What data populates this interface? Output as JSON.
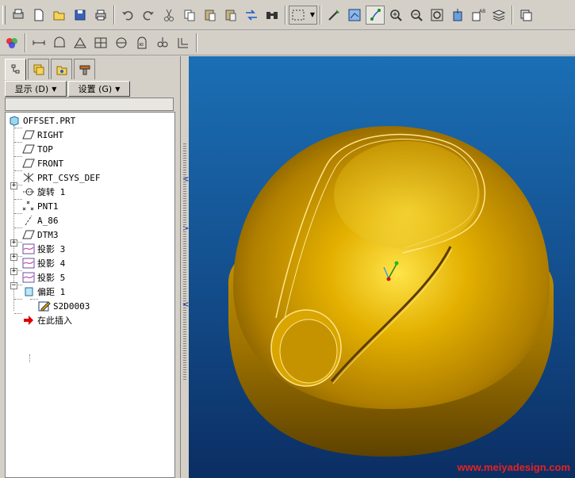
{
  "toolbar1": {
    "buttons": [
      "print-setup-icon",
      "new-icon",
      "open-icon",
      "save-icon",
      "print-icon",
      "undo-icon",
      "redo-icon",
      "cut-icon",
      "copy-icon",
      "paste-icon",
      "paste-special-icon",
      "regenerate-icon",
      "find-icon",
      "selection-box-icon",
      "repaint-icon",
      "spin-center-icon",
      "orient-icon",
      "zoom-in-icon",
      "zoom-out-icon",
      "refit-icon",
      "saved-view-icon",
      "annotation-display-icon",
      "layers-icon",
      "window-icon"
    ]
  },
  "toolbar2": {
    "buttons": [
      "model-display-icon",
      "datum-planes-icon",
      "datum-axes-icon",
      "datum-points-icon",
      "coord-sys-icon",
      "shading-icon",
      "wireframe-icon",
      "hidden-line-icon",
      "no-hidden-icon"
    ]
  },
  "panel": {
    "tabs": [
      "model-tree-tab",
      "layer-tree-tab",
      "favorites-tab",
      "tools-tab"
    ],
    "show_menu": "显示 (D)",
    "settings_menu": "设置 (G)"
  },
  "tree": {
    "items": [
      {
        "label": "OFFSET.PRT",
        "icon": "part-icon"
      },
      {
        "label": "RIGHT",
        "icon": "datum-plane-icon"
      },
      {
        "label": "TOP",
        "icon": "datum-plane-icon"
      },
      {
        "label": "FRONT",
        "icon": "datum-plane-icon"
      },
      {
        "label": "PRT_CSYS_DEF",
        "icon": "coordinate-system-icon"
      },
      {
        "label": "旋转 1",
        "icon": "revolve-icon"
      },
      {
        "label": "PNT1",
        "icon": "datum-point-icon"
      },
      {
        "label": "A_86",
        "icon": "datum-axis-icon"
      },
      {
        "label": "DTM3",
        "icon": "datum-plane-icon"
      },
      {
        "label": "投影 3",
        "icon": "projected-curve-icon"
      },
      {
        "label": "投影 4",
        "icon": "projected-curve-icon"
      },
      {
        "label": "投影 5",
        "icon": "projected-curve-icon"
      },
      {
        "label": "偏距 1",
        "icon": "offset-icon"
      },
      {
        "label": "S2D0003",
        "icon": "sketch-icon"
      },
      {
        "label": "在此插入",
        "icon": "insert-here-arrow-icon"
      }
    ]
  },
  "viewport": {
    "watermark": "www.meiyadesign.com"
  },
  "colors": {
    "background_top": "#1b6fb5",
    "background_bottom": "#0b2e63",
    "model_gold": "#e0a800",
    "edge_highlight": "#ffe68a",
    "watermark": "#e52222"
  }
}
